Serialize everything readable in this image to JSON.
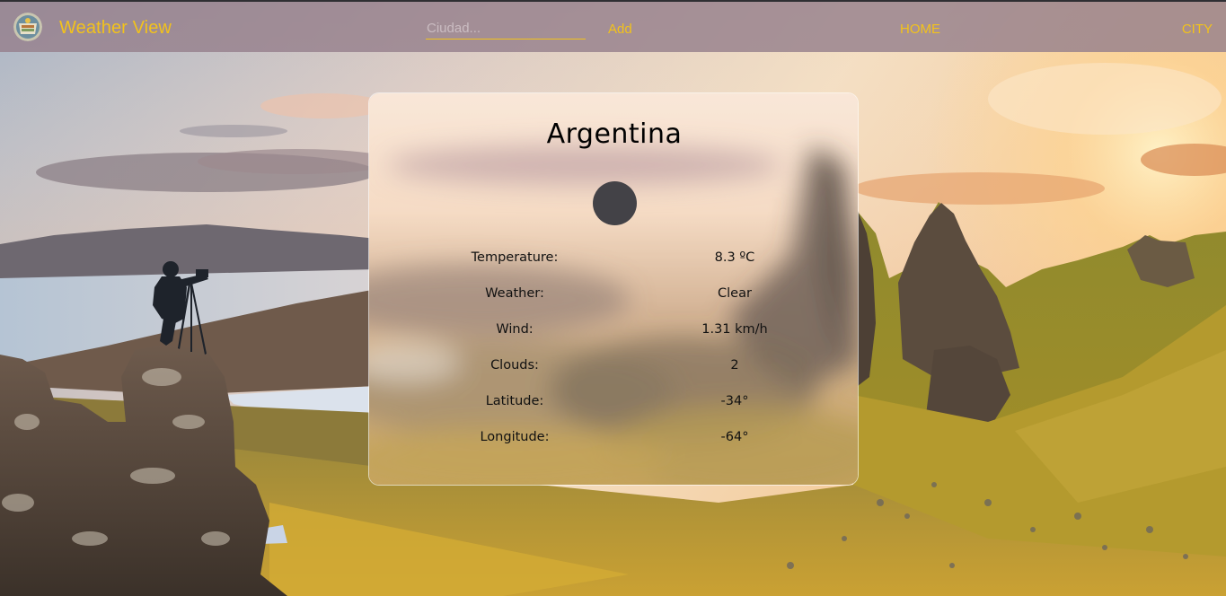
{
  "navbar": {
    "title": "Weather View",
    "search_placeholder": "Ciudad...",
    "search_value": "",
    "add_label": "Add",
    "home_label": "HOME",
    "city_label": "CITY"
  },
  "card": {
    "city": "Argentina",
    "icon": "weather-icon",
    "stats": [
      {
        "label": "Temperature:",
        "value": "8.3 ºC"
      },
      {
        "label": "Weather:",
        "value": "Clear"
      },
      {
        "label": "Wind:",
        "value": "1.31 km/h"
      },
      {
        "label": "Clouds:",
        "value": "2"
      },
      {
        "label": "Latitude:",
        "value": "-34°"
      },
      {
        "label": "Longitude:",
        "value": "-64°"
      }
    ]
  },
  "colors": {
    "accent": "#f2c21b",
    "navbar_bg": "#96808c",
    "icon_fill": "#434247",
    "text_dark": "#111111"
  }
}
